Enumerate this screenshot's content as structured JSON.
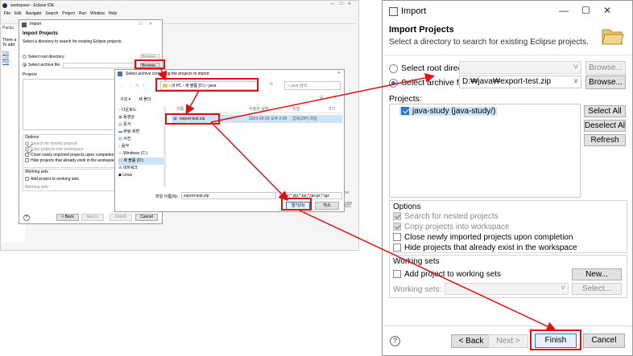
{
  "eclipse": {
    "title": "workspace - Eclipse IDE",
    "menu": [
      "File",
      "Edit",
      "Navigate",
      "Search",
      "Project",
      "Run",
      "Window",
      "Help"
    ],
    "package_tab": "Packa",
    "hint1": "There a",
    "hint2": "To add",
    "links": [
      "Cre",
      "Cre",
      "Imp"
    ],
    "right_panel": "Javaoe",
    "right_panel2": "Java-exe",
    "bottom_status": "2021"
  },
  "small_dialog": {
    "title": "Import",
    "header": "Import Projects",
    "desc": "Select a directory to search for existing Eclipse projects.",
    "root_label": "Select root directory:",
    "archive_label": "Select archive file:",
    "browse1": "Browse...",
    "browse2": "Browse...",
    "projects_label": "Projects",
    "options_label": "Options",
    "opt1": "Search for nested projects",
    "opt2": "Copy projects into workspace",
    "opt3": "Close newly imported projects upon completion",
    "opt4": "Hide projects that already exist in the workspace",
    "ws_label": "Working sets",
    "ws_add": "Add project to working sets",
    "ws_field": "Working sets:",
    "back": "< Back",
    "next": "Next >",
    "finish": "Finish",
    "cancel": "Cancel"
  },
  "file_dialog": {
    "title": "Select archive containing the projects to import",
    "path": [
      "내 PC",
      "새 볼륨 (D:)",
      "java"
    ],
    "search_placeholder": "java 검색",
    "organize": "구성 ▾",
    "new_folder": "새 폴더",
    "tree": [
      "다운로드",
      "동영상",
      "문서",
      "바탕 화면",
      "사진",
      "음악",
      "Windows (C:)",
      "새 볼륨 (D:)",
      "네트워크",
      "Linux"
    ],
    "col_name": "이름",
    "col_date": "수정한 날짜",
    "col_type": "유형",
    "col_size": "크기",
    "file_name": "export-test.zip",
    "file_date": "2023-09-29 오후 2:00",
    "file_type": "압축(ZIP) 파일",
    "filename_label": "파일 이름(N):",
    "filename_value": "export-test.zip",
    "filter": "*.jar;*.zip;*.tar;*.tar.gz;*.tgz",
    "open": "열기(O)",
    "cancel": "취소"
  },
  "big_dialog": {
    "title": "Import",
    "header": "Import Projects",
    "desc": "Select a directory to search for existing Eclipse projects.",
    "root_label": "Select root directory:",
    "archive_label": "Select archive file:",
    "archive_value": "D:₩java₩export-test.zip",
    "browse1": "Browse...",
    "browse2": "Browse...",
    "projects_label": "Projects:",
    "project_item": "java-study (java-study/)",
    "select_all": "Select All",
    "deselect_all": "Deselect All",
    "refresh": "Refresh",
    "options_label": "Options",
    "opt1": "Search for nested projects",
    "opt2": "Copy projects into workspace",
    "opt3": "Close newly imported projects upon completion",
    "opt4": "Hide projects that already exist in the workspace",
    "ws_label": "Working sets",
    "ws_add": "Add project to working sets",
    "ws_new": "New...",
    "ws_field": "Working sets:",
    "ws_select": "Select...",
    "help": "?",
    "back": "< Back",
    "next": "Next >",
    "finish": "Finish",
    "cancel": "Cancel"
  },
  "colors": {
    "accent": "#2e74c9",
    "highlight": "#e01010",
    "folder": "#e8c46a"
  }
}
